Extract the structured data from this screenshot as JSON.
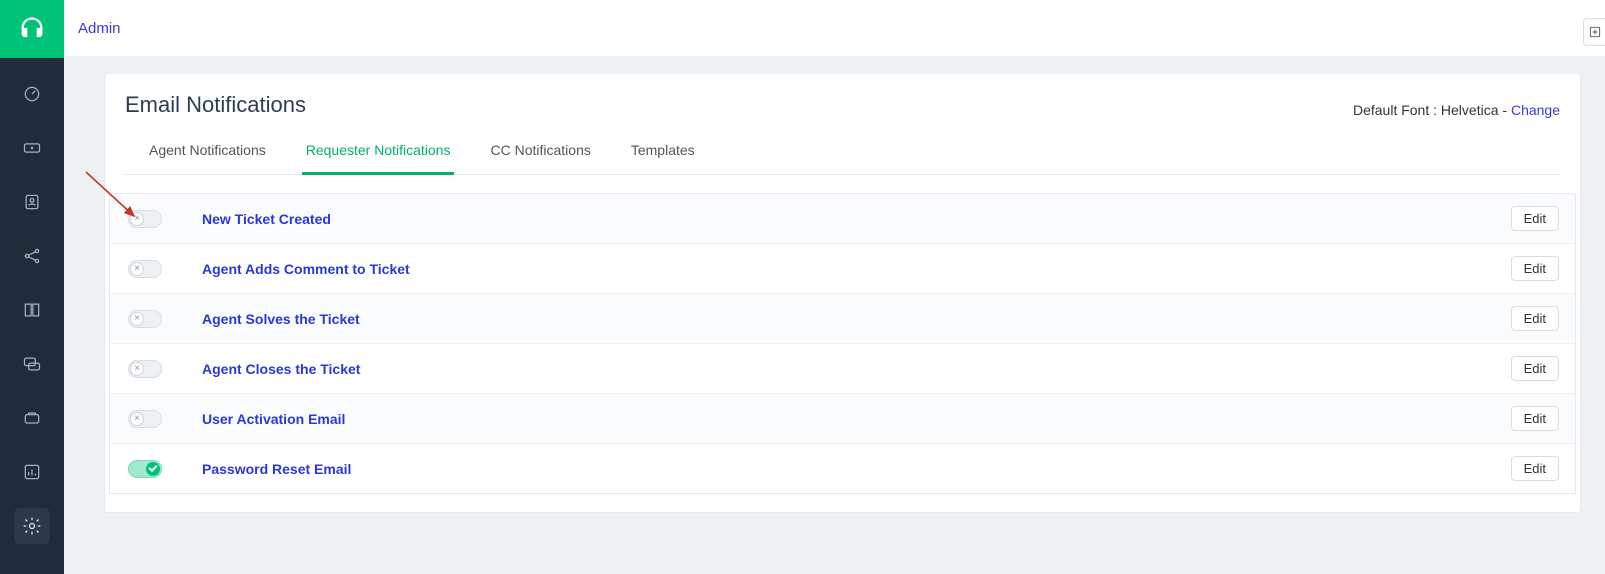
{
  "breadcrumb": "Admin",
  "page_title": "Email Notifications",
  "font_info": {
    "label": "Default Font : ",
    "font_name": "Helvetica",
    "separator": " - ",
    "change_label": "Change"
  },
  "tabs": [
    {
      "label": "Agent Notifications",
      "active": false
    },
    {
      "label": "Requester Notifications",
      "active": true
    },
    {
      "label": "CC Notifications",
      "active": false
    },
    {
      "label": "Templates",
      "active": false
    }
  ],
  "rows": [
    {
      "title": "New Ticket Created",
      "enabled": false,
      "edit": "Edit"
    },
    {
      "title": "Agent Adds Comment to Ticket",
      "enabled": false,
      "edit": "Edit"
    },
    {
      "title": "Agent Solves the Ticket",
      "enabled": false,
      "edit": "Edit"
    },
    {
      "title": "Agent Closes the Ticket",
      "enabled": false,
      "edit": "Edit"
    },
    {
      "title": "User Activation Email",
      "enabled": false,
      "edit": "Edit"
    },
    {
      "title": "Password Reset Email",
      "enabled": true,
      "edit": "Edit"
    }
  ],
  "sidebar_icons": [
    "dashboard-icon",
    "tickets-icon",
    "contacts-icon",
    "social-icon",
    "knowledge-icon",
    "chat-icon",
    "assets-icon",
    "reports-icon",
    "settings-icon"
  ]
}
